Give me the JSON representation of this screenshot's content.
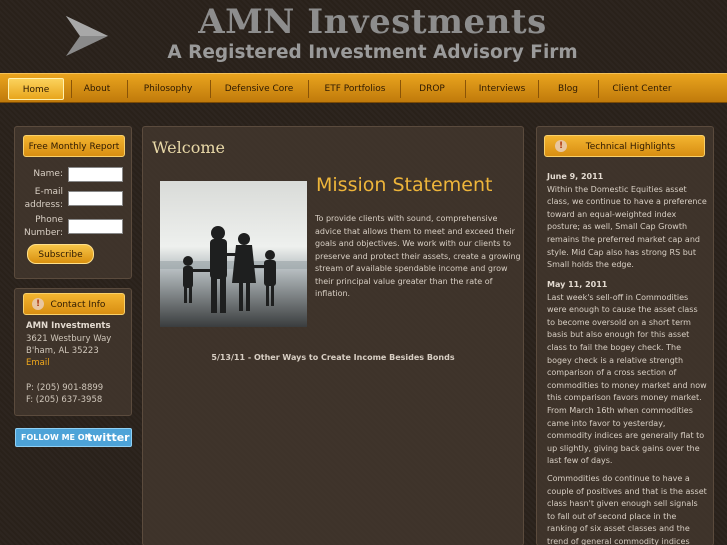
{
  "header": {
    "title": "AMN Investments",
    "subtitle": "A Registered Investment Advisory Firm",
    "logo_icon": "arrow-logo-icon"
  },
  "nav": {
    "items": [
      "Home",
      "About",
      "Philosophy",
      "Defensive Core",
      "ETF Portfolios",
      "DROP",
      "Interviews",
      "Blog",
      "Client Center"
    ],
    "active": "Home"
  },
  "newsletter": {
    "tab_label": "Free Monthly Report",
    "name_label": "Name:",
    "email_label_1": "E-mail",
    "email_label_2": "address:",
    "phone_label_1": "Phone",
    "phone_label_2": "Number:",
    "name_value": "",
    "email_value": "",
    "phone_value": "",
    "subscribe_label": "Subscribe"
  },
  "contact": {
    "tab_label": "Contact Info",
    "company": "AMN Investments",
    "street": "3621 Westbury Way",
    "city": "B'ham, AL 35223",
    "email_link": "Email",
    "phone": "P: (205) 901-8899",
    "fax": "F: (205) 637-3958"
  },
  "twitter": {
    "follow_text": "FOLLOW ME ON",
    "brand": "twitter"
  },
  "main": {
    "heading": "Welcome",
    "mission_title": "Mission Statement",
    "mission_body": "To provide clients with sound, comprehensive advice that allows them to meet and exceed their goals and objectives. We work with our clients to preserve and protect their assets, create a growing stream of available spendable income and grow their principal value greater than the rate of inflation.",
    "news_link": "5/13/11 - Other Ways to Create Income Besides Bonds"
  },
  "technical": {
    "tab_label": "Technical Highlights",
    "entries": [
      {
        "date": "June 9, 2011",
        "text": "Within the Domestic Equities asset class, we continue to have a preference toward an equal-weighted index posture; as well, Small Cap Growth remains the preferred market cap and style. Mid Cap also has strong RS but Small holds the edge."
      },
      {
        "date": "May 11, 2011",
        "text": "Last week's sell-off in Commodities were enough to cause the asset class to become oversold on a short term basis but also enough for this asset class to fail the bogey check. The bogey check is a relative strength comparison of a cross section of commodities to money market and now this comparison favors money market. From March 16th when commodities came into favor to yesterday, commodity indices are generally flat to up slightly, giving back gains over the last few of days."
      },
      {
        "date": "",
        "text": "Commodities do continue to have a couple of positives and that is the asset class hasn't given enough sell signals to fall out of second place in the ranking of six asset classes and the trend of general commodity indices"
      }
    ]
  },
  "colors": {
    "background": "#2a221b",
    "accent_orange": "#e9a41e",
    "title_gold": "#eeb53a",
    "text_light": "#d8cfc4"
  }
}
